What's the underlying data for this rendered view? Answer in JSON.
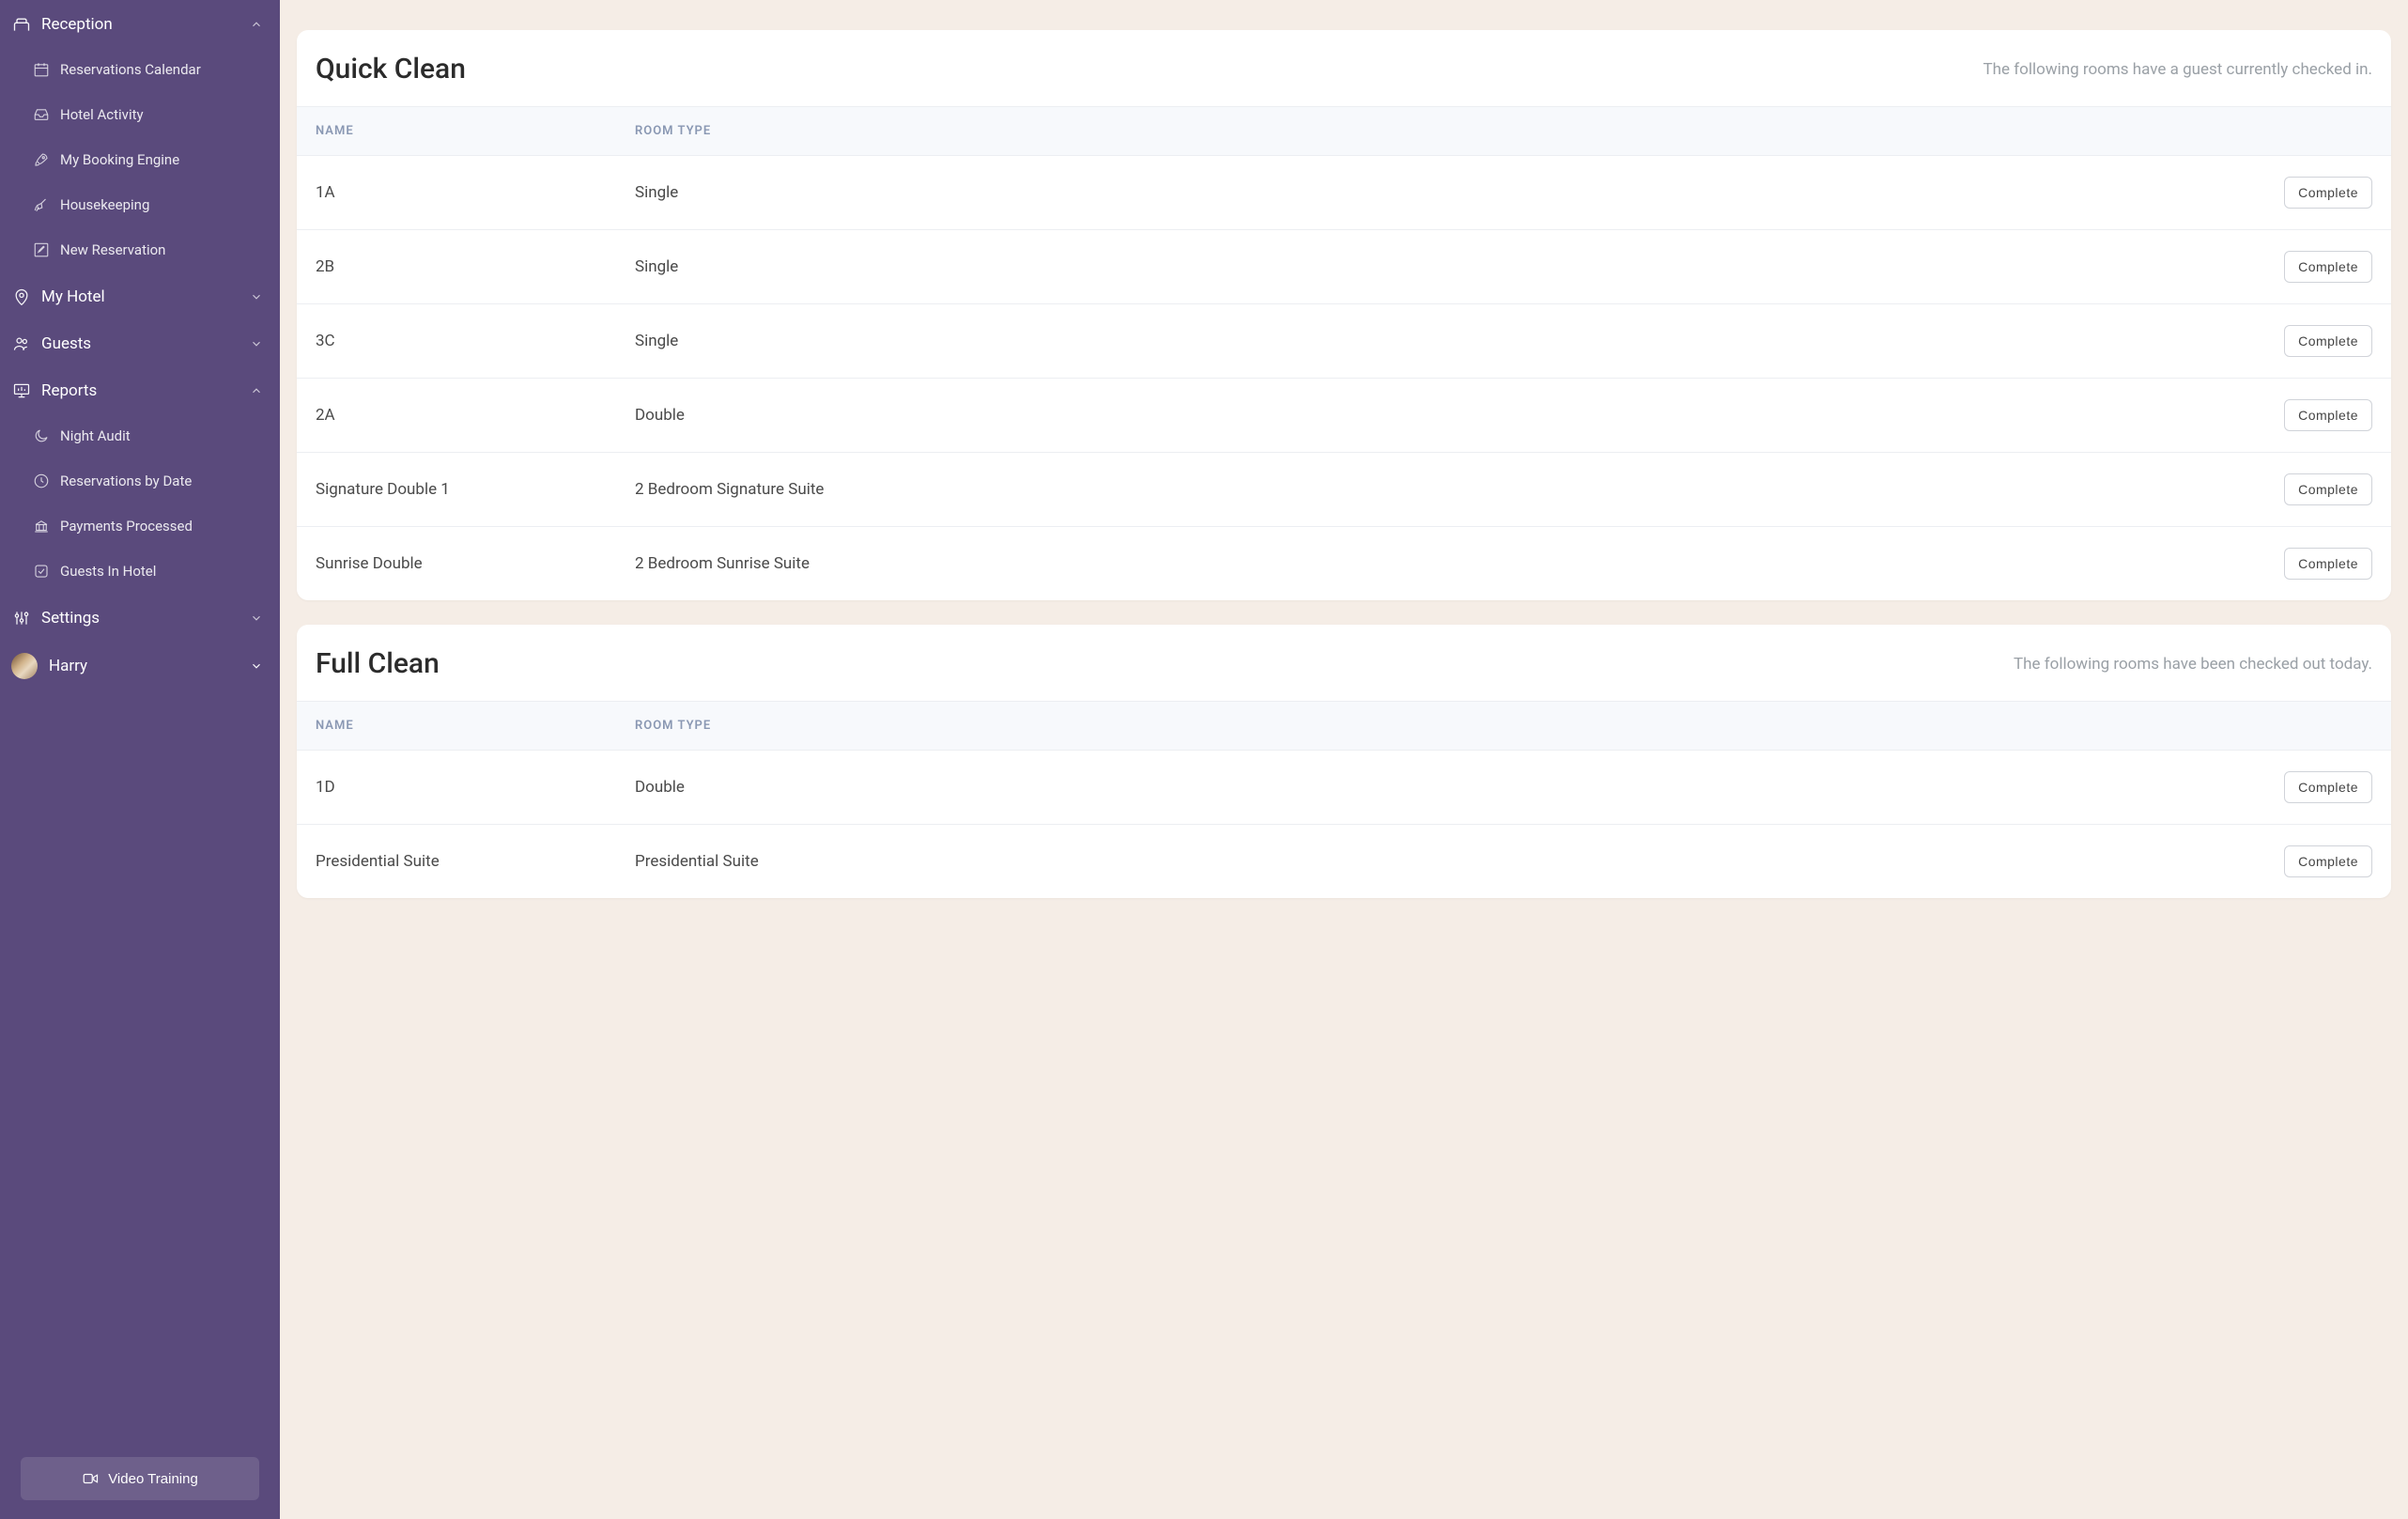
{
  "sidebar": {
    "sections": [
      {
        "id": "reception",
        "label": "Reception",
        "expanded": true,
        "items": [
          {
            "id": "reservations-calendar",
            "label": "Reservations Calendar"
          },
          {
            "id": "hotel-activity",
            "label": "Hotel Activity"
          },
          {
            "id": "my-booking-engine",
            "label": "My Booking Engine"
          },
          {
            "id": "housekeeping",
            "label": "Housekeeping"
          },
          {
            "id": "new-reservation",
            "label": "New Reservation"
          }
        ]
      },
      {
        "id": "my-hotel",
        "label": "My Hotel",
        "expanded": false
      },
      {
        "id": "guests",
        "label": "Guests",
        "expanded": false
      },
      {
        "id": "reports",
        "label": "Reports",
        "expanded": true,
        "items": [
          {
            "id": "night-audit",
            "label": "Night Audit"
          },
          {
            "id": "reservations-by-date",
            "label": "Reservations by Date"
          },
          {
            "id": "payments-processed",
            "label": "Payments Processed"
          },
          {
            "id": "guests-in-hotel",
            "label": "Guests In Hotel"
          }
        ]
      },
      {
        "id": "settings",
        "label": "Settings",
        "expanded": false
      }
    ],
    "user": {
      "name": "Harry"
    },
    "videoTraining": "Video Training"
  },
  "cards": [
    {
      "id": "quick-clean",
      "title": "Quick Clean",
      "subtitle": "The following rooms have a guest currently checked in.",
      "columns": {
        "name": "NAME",
        "type": "ROOM TYPE"
      },
      "actionLabel": "Complete",
      "rows": [
        {
          "name": "1A",
          "type": "Single"
        },
        {
          "name": "2B",
          "type": "Single"
        },
        {
          "name": "3C",
          "type": "Single"
        },
        {
          "name": "2A",
          "type": "Double"
        },
        {
          "name": "Signature Double 1",
          "type": "2 Bedroom Signature Suite"
        },
        {
          "name": "Sunrise Double",
          "type": "2 Bedroom Sunrise Suite"
        }
      ]
    },
    {
      "id": "full-clean",
      "title": "Full Clean",
      "subtitle": "The following rooms have been checked out today.",
      "columns": {
        "name": "NAME",
        "type": "ROOM TYPE"
      },
      "actionLabel": "Complete",
      "rows": [
        {
          "name": "1D",
          "type": "Double"
        },
        {
          "name": "Presidential Suite",
          "type": "Presidential Suite"
        }
      ]
    }
  ]
}
